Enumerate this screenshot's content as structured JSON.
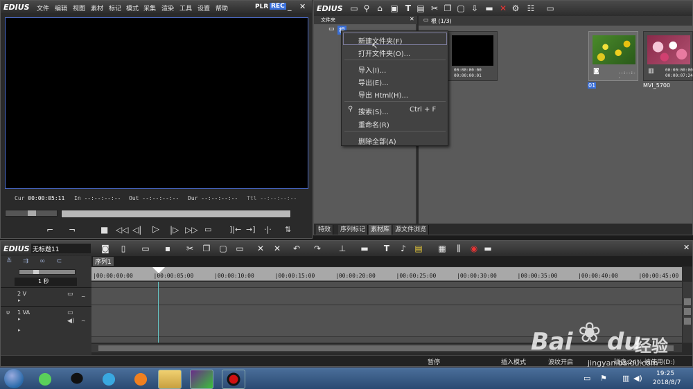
{
  "player": {
    "logo": "EDIUS",
    "menu": [
      "文件",
      "编辑",
      "视图",
      "素材",
      "标记",
      "模式",
      "采集",
      "渲染",
      "工具",
      "设置",
      "帮助"
    ],
    "plr": "PLR",
    "rec": "REC",
    "timecodes": {
      "cur_label": "Cur",
      "cur": "00:00:05:11",
      "in_label": "In",
      "in": "--:--:--:--",
      "out_label": "Out",
      "out": "--:--:--:--",
      "dur_label": "Dur",
      "dur": "--:--:--:--",
      "ttl_label": "Ttl",
      "ttl": "--:--:--:--"
    }
  },
  "bin": {
    "logo": "EDIUS",
    "folder_header": "文件夹",
    "root_folder": "根",
    "path": "根 (1/3)",
    "clips": [
      {
        "name": "",
        "tc1": "00:00:00:00",
        "tc2": "00:00:00:01",
        "type": "video"
      },
      {
        "name": "01",
        "tc1": "",
        "tc2": "--:--:--",
        "type": "still"
      },
      {
        "name": "MVI_5700",
        "tc1": "00:00:00:00",
        "tc2": "00:00:07:24",
        "type": "video"
      }
    ],
    "tabs": [
      "特效",
      "序列标记",
      "素材库",
      "源文件浏览"
    ]
  },
  "context_menu": {
    "items": [
      {
        "label": "新建文件夹(F)",
        "shortcut": ""
      },
      {
        "label": "打开文件夹(O)...",
        "shortcut": ""
      },
      {
        "label": "导入(I)...",
        "shortcut": ""
      },
      {
        "label": "导出(E)...",
        "shortcut": ""
      },
      {
        "label": "导出 Html(H)...",
        "shortcut": ""
      },
      {
        "label": "搜索(S)...",
        "shortcut": "Ctrl + F"
      },
      {
        "label": "重命名(R)",
        "shortcut": ""
      },
      {
        "label": "删除全部(A)",
        "shortcut": ""
      }
    ]
  },
  "timeline": {
    "logo": "EDIUS",
    "project_name": "无标题11",
    "sequence_tab": "序列1",
    "scale": "1 秒",
    "ruler": [
      "00:00:00:00",
      "00:00:05:00",
      "00:00:10:00",
      "00:00:15:00",
      "00:00:20:00",
      "00:00:25:00",
      "00:00:30:00",
      "00:00:35:00",
      "00:00:40:00",
      "00:00:45:00"
    ],
    "tracks": [
      "2 V",
      "1 VA"
    ]
  },
  "status": {
    "state": "暂停",
    "mode": "插入模式",
    "ripple": "波纹开启",
    "disk": "磁盘:24% 被使用(D:)"
  },
  "taskbar": {
    "time": "19:25",
    "date": "2018/8/7"
  },
  "watermark": {
    "brand": "Bai",
    "brand2": "du",
    "cn": "经验",
    "url": "jingyan.baidu.com"
  },
  "colors": {
    "accent_blue": "#3a6fd8",
    "rec_red": "#c41010",
    "playhead": "#66c6c6",
    "menu_bg": "#424242"
  }
}
